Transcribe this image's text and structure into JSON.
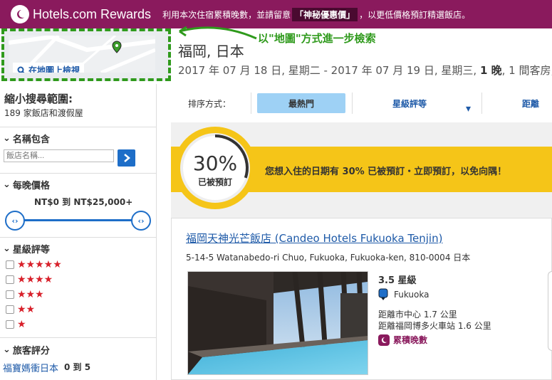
{
  "header": {
    "brand": "Hotels.com Rewards",
    "promo_before": "利用本次住宿累積晚數，並請留意",
    "promo_highlight": "「神秘優惠價」",
    "promo_after": "，以更低價格預訂精選飯店。"
  },
  "map": {
    "link_label": "在地圖上檢視",
    "annotation": "以\"地圖\"方式進一步檢索"
  },
  "search": {
    "city": "福岡, 日本",
    "dates_text": "2017 年 07 月 18 日, 星期二 - 2017 年 07 月 19 日, 星期三,",
    "nights": "1 晚",
    "rooms_text": ", 1 間客房,"
  },
  "sidebar": {
    "title": "縮小搜尋範圍:",
    "count": "189 家飯店和渡假屋",
    "name_section": {
      "heading": "名稱包含",
      "placeholder": "飯店名稱..."
    },
    "price_section": {
      "heading": "每晚價格",
      "min": "NT$0",
      "to": "到",
      "max": "NT$25,000+",
      "range_low": 0,
      "range_high": 1
    },
    "star_section": {
      "heading": "星級評等",
      "options": [
        5,
        4,
        3,
        2,
        1
      ]
    },
    "guest_section": {
      "heading": "旅客評分",
      "link": "福寶媽衝日本",
      "min": "0",
      "to": "到",
      "max": "5"
    }
  },
  "sort": {
    "label": "排序方式：",
    "tabs": [
      {
        "label": "最熱門",
        "active": true
      },
      {
        "label": "星級評等",
        "active": false
      },
      {
        "label": "距離",
        "active": false
      }
    ]
  },
  "booked_banner": {
    "percent": "30%",
    "sub": "已被預訂",
    "message": "您想入住的日期有 30% 已被預訂・立即預訂，以免向隅！",
    "fill_fraction": 0.3
  },
  "hotel": {
    "name": "福岡天神光芒飯店 (Candeo Hotels Fukuoka Tenjin)",
    "address": "5-14-5 Watanabedo-ri Chuo, Fukuoka, Fukuoka-ken, 810-0004 日本",
    "rating": "3.5 星級",
    "location": "Fukuoka",
    "dist_center": "距離市中心 1.7 公里",
    "dist_station": "距離福岡博多火車站 1.6 公里",
    "rewards": "累積晚數"
  },
  "colors": {
    "brand": "#8a1a5d",
    "accent": "#1e6ec8",
    "banner": "#f5c518",
    "highlight_green": "#2f9a1c"
  }
}
